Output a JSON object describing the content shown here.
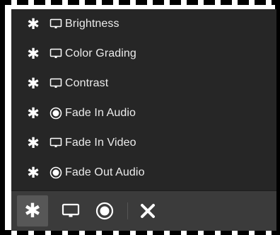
{
  "effects": [
    {
      "label": "Brightness",
      "icon": "monitor-icon"
    },
    {
      "label": "Color Grading",
      "icon": "monitor-icon"
    },
    {
      "label": "Contrast",
      "icon": "monitor-icon"
    },
    {
      "label": "Fade In Audio",
      "icon": "audio-disc-icon"
    },
    {
      "label": "Fade In Video",
      "icon": "monitor-icon"
    },
    {
      "label": "Fade Out Audio",
      "icon": "audio-disc-icon"
    }
  ],
  "toolbar": {
    "favorites_icon": "asterisk-icon",
    "video_filter_icon": "monitor-icon",
    "audio_filter_icon": "audio-disc-icon",
    "close_icon": "close-icon",
    "active": "favorites"
  },
  "colors": {
    "panel_bg": "#262626",
    "toolbar_bg": "#3b3b3b",
    "active_button_bg": "#575757",
    "text": "#ececec"
  }
}
